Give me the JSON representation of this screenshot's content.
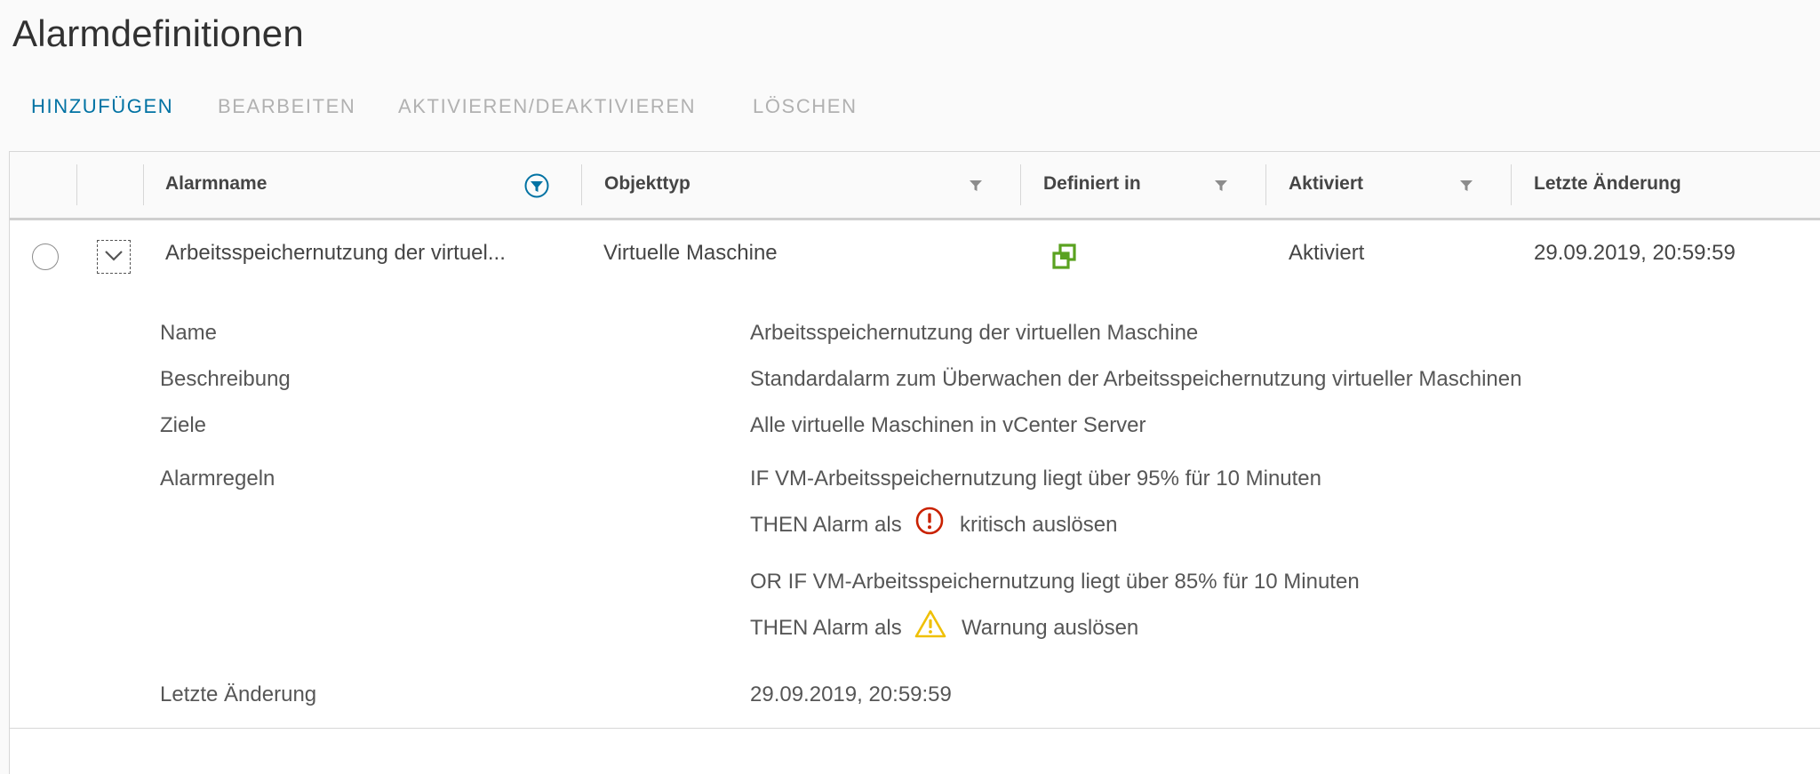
{
  "page": {
    "title": "Alarmdefinitionen"
  },
  "toolbar": {
    "add": "HINZUFÜGEN",
    "edit": "BEARBEITEN",
    "toggle": "AKTIVIEREN/DEAKTIVIEREN",
    "delete": "LÖSCHEN"
  },
  "columns": {
    "name": "Alarmname",
    "object_type": "Objekttyp",
    "defined_in": "Definiert in",
    "enabled": "Aktiviert",
    "last_modified": "Letzte Änderung"
  },
  "row": {
    "name": "Arbeitsspeichernutzung der virtuel...",
    "object_type": "Virtuelle Maschine",
    "defined_in_icon": "vcenter-icon",
    "enabled": "Aktiviert",
    "last_modified": "29.09.2019, 20:59:59"
  },
  "details": {
    "name_label": "Name",
    "name_value": "Arbeitsspeichernutzung der virtuellen Maschine",
    "description_label": "Beschreibung",
    "description_value": "Standardalarm zum Überwachen der Arbeitsspeichernutzung virtueller Maschinen",
    "targets_label": "Ziele",
    "targets_value": "Alle virtuelle Maschinen in vCenter Server",
    "rules_label": "Alarmregeln",
    "rule1_if": "IF VM-Arbeitsspeichernutzung liegt über 95% für 10 Minuten",
    "rule1_then_prefix": "THEN Alarm als",
    "rule1_then_suffix": "kritisch auslösen",
    "rule2_if": "OR IF VM-Arbeitsspeichernutzung liegt über 85% für 10 Minuten",
    "rule2_then_prefix": "THEN Alarm als",
    "rule2_then_suffix": "Warnung auslösen",
    "last_modified_label": "Letzte Änderung",
    "last_modified_value": "29.09.2019, 20:59:59"
  },
  "colors": {
    "accent": "#0072a3",
    "critical": "#c92100",
    "warning": "#efc006",
    "vcenter": "#5aa220"
  }
}
